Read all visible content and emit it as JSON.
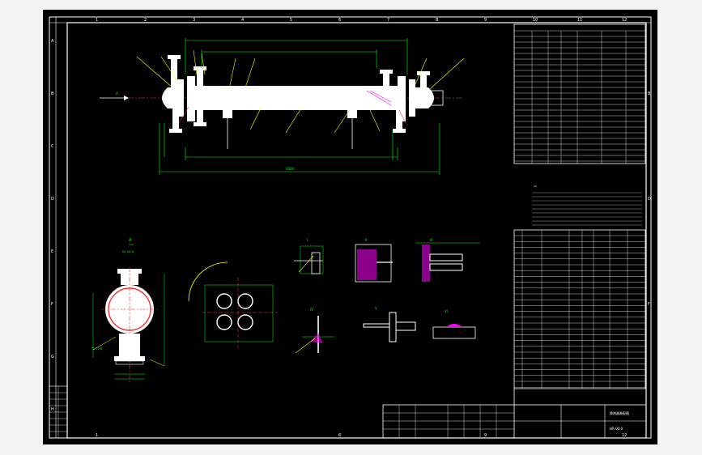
{
  "colors": {
    "background": "#000000",
    "frame": "#ffffff",
    "dimension": "#00ff00",
    "leader": "#ffff00",
    "leader_alt": "#ff0000",
    "center_line": "#ff3030",
    "hatch": "#ff00ff",
    "accent": "#00ffff",
    "part_fill": "#ffffff"
  },
  "border": {
    "top_numbers": [
      "1",
      "2",
      "3",
      "4",
      "5",
      "6",
      "7",
      "8",
      "9",
      "10",
      "11",
      "12"
    ],
    "side_letters": [
      "A",
      "B",
      "C",
      "D",
      "E",
      "F",
      "G",
      "H"
    ]
  },
  "main_view": {
    "overall_dimension": "3000",
    "left_arrow_label": "A"
  },
  "section_view": {
    "label": "A",
    "nozzle_label_top": "N1,N2,A",
    "nozzle_label_bottom": "T1,T2,B"
  },
  "detail_views": [
    "I",
    "II",
    "III",
    "IV",
    "V",
    "VI"
  ],
  "title_block": {
    "drawing_title": "换热器装配图",
    "drawing_number": "HR-00-0"
  },
  "icons": [
    "weld-symbol-icon",
    "section-arrow-icon"
  ]
}
